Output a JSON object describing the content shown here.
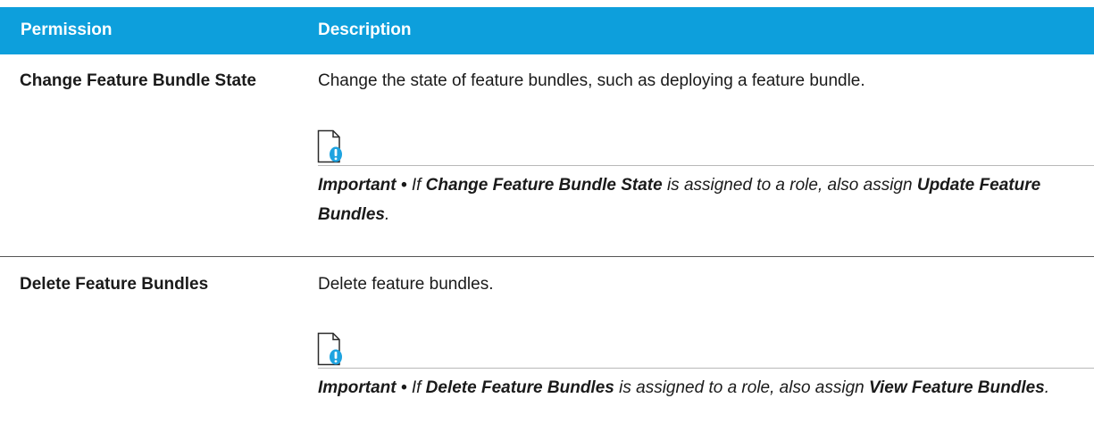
{
  "header": {
    "permission_col": "Permission",
    "description_col": "Description"
  },
  "rows": [
    {
      "permission": "Change Feature Bundle State",
      "description": "Change the state of feature bundles, such as deploying a feature bundle.",
      "note": {
        "label": "Important",
        "separator": "•",
        "prefix": "If",
        "subject": "Change Feature Bundle State",
        "middle": "is assigned to a role, also assign",
        "target": "Update Feature Bundles",
        "end": "."
      }
    },
    {
      "permission": "Delete Feature Bundles",
      "description": "Delete feature bundles.",
      "note": {
        "label": "Important",
        "separator": "•",
        "prefix": "If",
        "subject": "Delete Feature Bundles",
        "middle": "is assigned to a role, also assign",
        "target": "View Feature Bundles",
        "end": "."
      }
    }
  ],
  "icons": {
    "note": "important-note-icon"
  },
  "colors": {
    "header_bg": "#0d9fdc",
    "header_text": "#ffffff",
    "icon_accent": "#1ea3e0"
  }
}
